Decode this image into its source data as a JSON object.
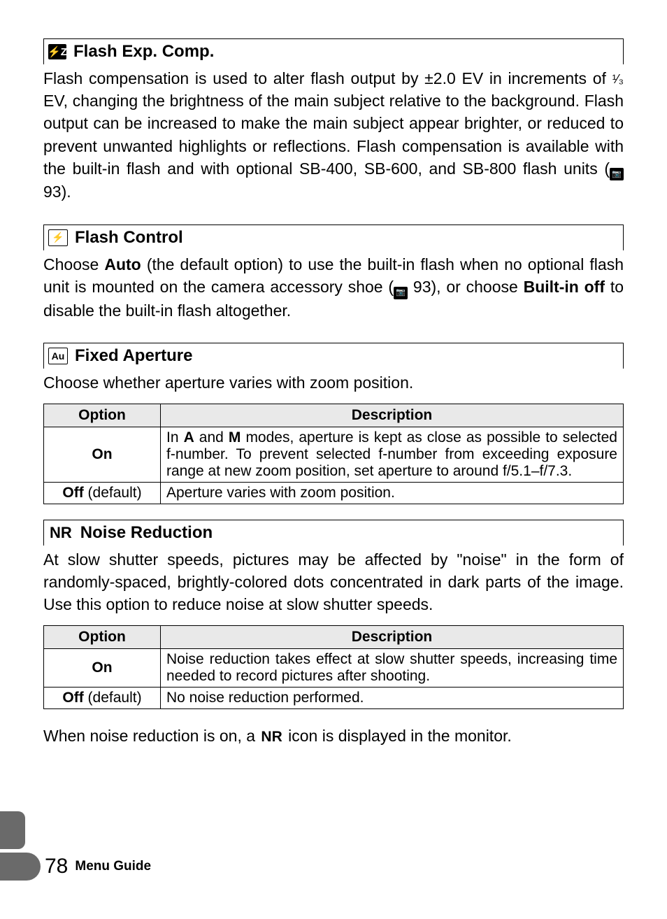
{
  "page_number": "78",
  "footer_title": "Menu Guide",
  "sections": {
    "flash_exp_comp": {
      "icon": "⚡Z",
      "title": "Flash Exp. Comp.",
      "body_pre": "Flash compensation is used to alter flash output by ±2.0 EV in increments of ",
      "frac": "¹⁄₃",
      "body_post": " EV, changing the brightness of the main subject relative to the background. Flash output can be increased to make the main subject appear brighter, or reduced to prevent unwanted highlights or reflections.  Flash compensation is available with the built-in flash and with optional SB-400, SB-600, and SB-800 flash units (",
      "ref_icon": "📷",
      "ref": " 93)."
    },
    "flash_control": {
      "icon": "⚡",
      "title": "Flash Control",
      "body_a": "Choose ",
      "bold_a": "Auto",
      "body_b": " (the default option) to use the built-in flash when no optional flash unit is mounted on the camera accessory shoe (",
      "ref_icon": "📷",
      "ref": " 93), or choose ",
      "bold_b": "Built-in off",
      "body_c": " to disable the built-in flash altogether."
    },
    "fixed_aperture": {
      "icon": "Au",
      "title": "Fixed Aperture",
      "intro": "Choose whether aperture varies with zoom position.",
      "table": {
        "headers": {
          "option": "Option",
          "description": "Description"
        },
        "rows": {
          "on": {
            "option": "On",
            "desc_a": "In ",
            "bold_a": "A",
            "desc_b": " and ",
            "bold_b": "M",
            "desc_c": " modes, aperture is kept as close as possible to selected f-number.  To prevent selected f-number from exceeding exposure range at new zoom position, set aperture to around f/5.1–f/7.3."
          },
          "off": {
            "option_bold": "Off",
            "option_rest": " (default)",
            "desc": "Aperture varies with zoom position."
          }
        }
      }
    },
    "noise_reduction": {
      "icon": "NR",
      "title": "Noise Reduction",
      "intro": "At slow shutter speeds, pictures may be affected by \"noise\" in the form of randomly-spaced, brightly-colored dots concentrated in dark parts of the image. Use this option to reduce noise at slow shutter speeds.",
      "table": {
        "headers": {
          "option": "Option",
          "description": "Description"
        },
        "rows": {
          "on": {
            "option": "On",
            "desc": "Noise reduction takes effect at slow shutter speeds, increasing time needed to record pictures after shooting."
          },
          "off": {
            "option_bold": "Off",
            "option_rest": " (default)",
            "desc": "No noise reduction performed."
          }
        }
      },
      "note_a": "When noise reduction is on, a ",
      "note_icon": "NR",
      "note_b": " icon is displayed in the monitor."
    }
  }
}
